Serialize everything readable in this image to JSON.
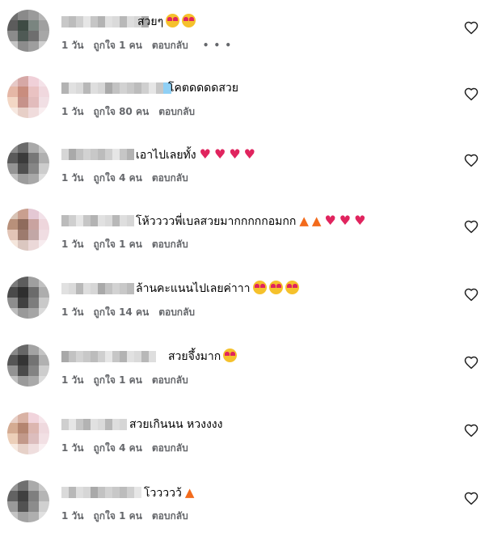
{
  "comments": [
    {
      "text": "สวยๆ",
      "emojis": [
        "face-hearts",
        "face-hearts"
      ],
      "time": "1 วัน",
      "likes": "ถูกใจ 1 คน",
      "reply": "ตอบกลับ",
      "more": "• • •",
      "name_width": 12,
      "avatar": [
        "#6f6f6f",
        "#8a8a8a",
        "#9a9a9a",
        "#b5b5b5",
        "#5c5c5c",
        "#3e4b44",
        "#7a8580",
        "#a0a0a0",
        "#8b8b8b",
        "#4f5a55",
        "#6e6e6e",
        "#a7a7a7",
        "#c5c5c5",
        "#8c8c8c",
        "#9e9e9e",
        "#d0d0d0"
      ]
    },
    {
      "text": "โคตดดดดสวย",
      "emojis": [],
      "time": "1 วัน",
      "likes": "ถูกใจ 80 คน",
      "reply": "ตอบกลับ",
      "name_width": 14,
      "avatar": [
        "#e6c9c7",
        "#d6a8a6",
        "#f0d0d8",
        "#f4e2e8",
        "#e5b7a6",
        "#c98d7e",
        "#e9c2c2",
        "#f0d8de",
        "#f3d7c5",
        "#c6928a",
        "#e2bcbc",
        "#f1dfe4",
        "#f7e8e0",
        "#e7cfc7",
        "#f0dcdc",
        "#f9eef0"
      ]
    },
    {
      "text": "เอาไปเลยทั้ง",
      "emojis": [
        "heart",
        "heart",
        "heart",
        "heart"
      ],
      "time": "1 วัน",
      "likes": "ถูกใจ 4 คน",
      "reply": "ตอบกลับ",
      "name_width": 10,
      "avatar": [
        "#8b8b8b",
        "#6a6a6a",
        "#a9a9a9",
        "#c5c5c5",
        "#5a5a5a",
        "#3b3b3b",
        "#777777",
        "#b0b0b0",
        "#949494",
        "#4f4f4f",
        "#868686",
        "#cccccc",
        "#c0c0c0",
        "#9c9c9c",
        "#a8a8a8",
        "#dedede"
      ]
    },
    {
      "text": "โห้ววววพี่เบลสวยมากกกกกอมกก",
      "emojis": [
        "fire",
        "fire",
        "heart",
        "heart",
        "heart"
      ],
      "time": "1 วัน",
      "likes": "ถูกใจ 1 คน",
      "reply": "ตอบกลับ",
      "name_width": 10,
      "avatar": [
        "#d8c3b5",
        "#c99f8f",
        "#e4c8d4",
        "#f2e1e8",
        "#b8907a",
        "#8f6b5c",
        "#c9a3a0",
        "#eed6dc",
        "#e3c5b7",
        "#9d7b6e",
        "#c2a7a6",
        "#f0dde2",
        "#f5e6dc",
        "#dbc7c0",
        "#ebd8d8",
        "#f7ecef"
      ]
    },
    {
      "text": "ล้านคะแนนไปเลยค่าาา",
      "emojis": [
        "face-hearts",
        "face-hearts",
        "face-hearts"
      ],
      "time": "1 วัน",
      "likes": "ถูกใจ 14 คน",
      "reply": "ตอบกลับ",
      "name_width": 10,
      "avatar": [
        "#7c7c7c",
        "#5d5d5d",
        "#9f9f9f",
        "#c1c1c1",
        "#4a4a4a",
        "#2f2f2f",
        "#6b6b6b",
        "#adadad",
        "#8e8e8e",
        "#414141",
        "#7d7d7d",
        "#c9c9c9",
        "#bdbdbd",
        "#999999",
        "#a5a5a5",
        "#dadada"
      ]
    },
    {
      "text": "สวยจึ้งมาก",
      "emojis": [
        "face-hearts"
      ],
      "time": "1 วัน",
      "likes": "ถูกใจ 1 คน",
      "reply": "ตอบกลับ",
      "name_width": 13,
      "avatar": [
        "#8a8a8a",
        "#676767",
        "#a3a3a3",
        "#c4c4c4",
        "#565656",
        "#353535",
        "#737373",
        "#b1b1b1",
        "#939393",
        "#4a4a4a",
        "#838383",
        "#cdcdcd",
        "#c0c0c0",
        "#9b9b9b",
        "#a9a9a9",
        "#dcdcdc"
      ]
    },
    {
      "text": "สวยเกินนน หวงงงง",
      "emojis": [],
      "time": "1 วัน",
      "likes": "ถูกใจ 4 คน",
      "reply": "ตอบกลับ",
      "name_width": 9,
      "avatar": [
        "#e8cfc6",
        "#d9b2a4",
        "#f1d4dc",
        "#f6e5ea",
        "#d4ab92",
        "#b48570",
        "#dcb6b0",
        "#efd9de",
        "#eccfb9",
        "#c2998a",
        "#dcbdbd",
        "#f2e0e4",
        "#f7eae1",
        "#e6d1c8",
        "#efdede",
        "#f9eff1"
      ]
    },
    {
      "text": "โววววว้",
      "emojis": [
        "fire"
      ],
      "time": "1 วัน",
      "likes": "ถูกใจ 1 คน",
      "reply": "ตอบกลับ",
      "name_width": 11,
      "avatar": [
        "#959595",
        "#707070",
        "#aaaaaa",
        "#c8c8c8",
        "#626262",
        "#404040",
        "#7f7f7f",
        "#b5b5b5",
        "#9a9a9a",
        "#525252",
        "#8c8c8c",
        "#d0d0d0",
        "#c4c4c4",
        "#a2a2a2",
        "#afafaf",
        "#e0e0e0"
      ]
    }
  ]
}
